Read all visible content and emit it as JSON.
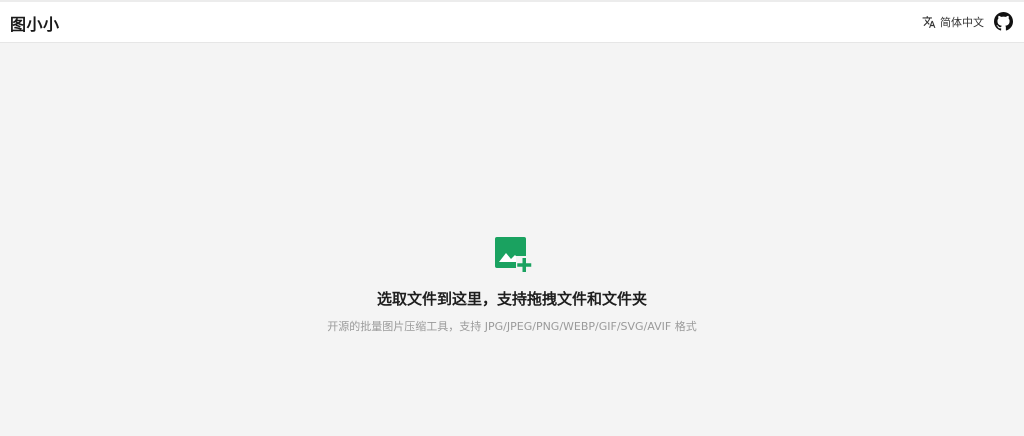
{
  "header": {
    "logo": "图小小",
    "language_label": "简体中文"
  },
  "icons": {
    "translate": "translate-icon",
    "github": "github-icon",
    "upload": "image-add-icon"
  },
  "dropzone": {
    "title": "选取文件到这里，支持拖拽文件和文件夹",
    "subtitle": "开源的批量图片压缩工具，支持 JPG/JPEG/PNG/WEBP/GIF/SVG/AVIF 格式"
  },
  "colors": {
    "accent": "#1aa260",
    "background": "#f4f4f4",
    "header": "#ffffff"
  }
}
